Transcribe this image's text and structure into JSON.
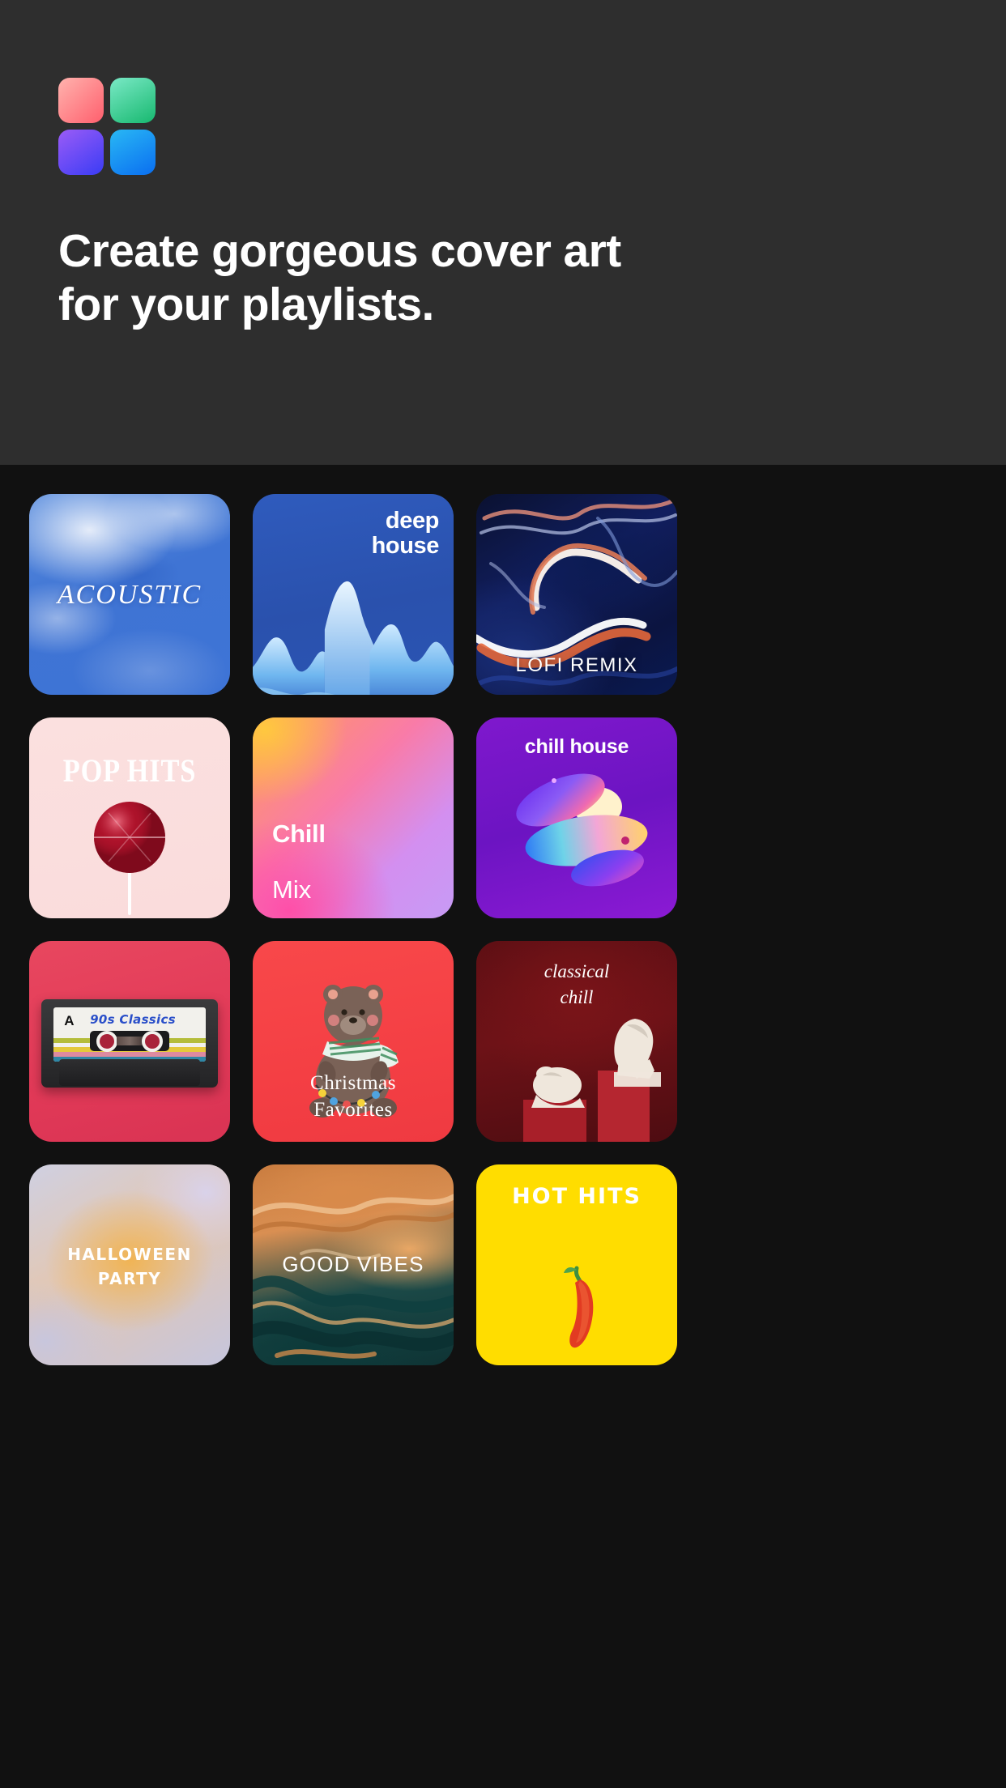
{
  "header": {
    "logo": {
      "name": "app-logo",
      "tiles": [
        {
          "name": "logo-tile-red",
          "from": "#ffb3ae",
          "to": "#ff5f6d"
        },
        {
          "name": "logo-tile-green",
          "from": "#7ae9c6",
          "to": "#17b86f"
        },
        {
          "name": "logo-tile-purple",
          "from": "#9b5cf6",
          "to": "#3a3cf5"
        },
        {
          "name": "logo-tile-blue",
          "from": "#29b8f5",
          "to": "#0a6ef0"
        }
      ]
    },
    "headline_line1": "Create gorgeous cover art",
    "headline_line2": "for your playlists.",
    "background": "#2e2e2e",
    "text_color": "#ffffff"
  },
  "gallery": {
    "background": "#111111",
    "columns": 3,
    "cards": [
      {
        "id": "acoustic",
        "title": "ACOUSTIC",
        "style": "serif-italic-uppercase",
        "art": "blue-cloud-watercolor",
        "accent": "#3f74d4"
      },
      {
        "id": "deep-house",
        "title": "deep\nhouse",
        "style": "bold-rounded-lowercase",
        "art": "blue-3d-wave-peaks",
        "accent": "#2a51ad"
      },
      {
        "id": "lofi-remix",
        "title": "LOFI REMIX",
        "style": "light-uppercase",
        "art": "navy-orange-liquid-marble",
        "accent": "#111e5e"
      },
      {
        "id": "pop-hits",
        "title": "POP HITS",
        "style": "condensed-serif-red",
        "art": "pink-lollipop",
        "accent": "#c00a20"
      },
      {
        "id": "chill-mix",
        "title_bold": "Chill",
        "title_regular": "Mix",
        "style": "two-line-left",
        "art": "orange-pink-purple-gradient",
        "accent": "#f97ba8"
      },
      {
        "id": "chill-house",
        "title": "chill house",
        "style": "bold-rounded-lowercase",
        "art": "purple-iridescent-discs",
        "accent": "#7f18cd"
      },
      {
        "id": "90s-classics",
        "title": "90s Classics",
        "style": "handwritten-blue-on-cassette",
        "art": "cassette-tape-on-red",
        "side_label": "A",
        "accent": "#e23a58"
      },
      {
        "id": "christmas-favorites",
        "title": "Christmas\nFavorites",
        "style": "serif-cream-two-line",
        "art": "bear-with-scarf-and-lights",
        "accent": "#f43f44"
      },
      {
        "id": "classical-chill",
        "title": "classical\nchill",
        "style": "serif-italic-two-line",
        "art": "marble-busts-on-dark-red",
        "accent": "#6d1217"
      },
      {
        "id": "halloween-party",
        "title": "HALLOWEEN\nPARTY",
        "style": "rounded-bold-cream",
        "art": "soft-pastel-orange-blur",
        "accent": "#e3c7b2"
      },
      {
        "id": "good-vibes",
        "title": "GOOD VIBES",
        "style": "light-uppercase",
        "art": "orange-teal-marble-swirl",
        "accent": "#c87b3e"
      },
      {
        "id": "hot-hits",
        "title": "HOT HITS",
        "style": "display-red-on-yellow",
        "art": "red-chili-pepper-on-yellow",
        "accent": "#e8192c"
      }
    ]
  }
}
